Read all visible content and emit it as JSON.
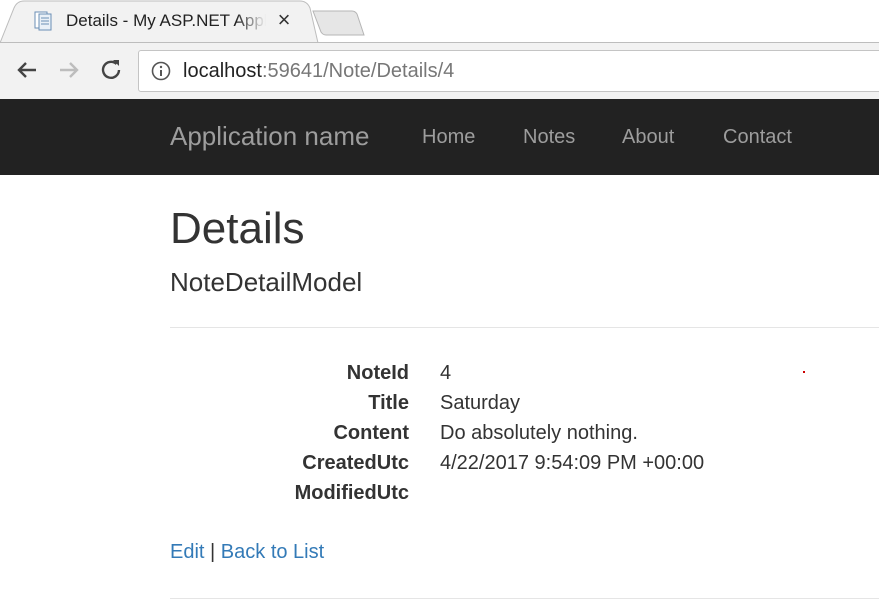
{
  "browser": {
    "tab_title": "Details - My ASP.NET Application",
    "tab_close_symbol": "×",
    "url_host": "localhost",
    "url_path": ":59641/Note/Details/4"
  },
  "navbar": {
    "brand": "Application name",
    "links": [
      "Home",
      "Notes",
      "About",
      "Contact"
    ],
    "background": "#222222",
    "link_color": "#9d9d9d"
  },
  "page": {
    "title": "Details",
    "subtitle": "NoteDetailModel",
    "fields": [
      {
        "label": "NoteId",
        "value": "4"
      },
      {
        "label": "Title",
        "value": "Saturday"
      },
      {
        "label": "Content",
        "value": "Do absolutely nothing."
      },
      {
        "label": "CreatedUtc",
        "value": "4/22/2017 9:54:09 PM +00:00"
      },
      {
        "label": "ModifiedUtc",
        "value": ""
      }
    ],
    "edit_link": "Edit",
    "separator": "|",
    "back_link": "Back to List",
    "link_color": "#337ab7"
  }
}
